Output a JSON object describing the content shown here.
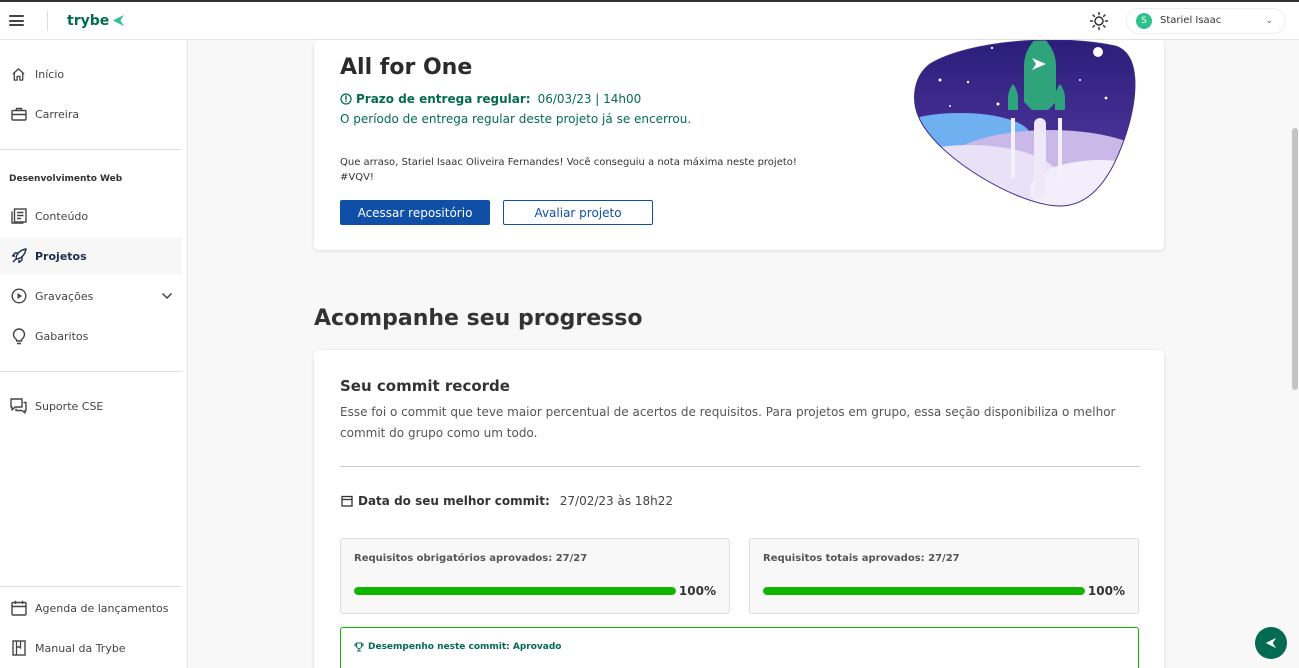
{
  "header": {
    "brand": "trybe",
    "user_initial": "S",
    "user_name": "Stariel Isaac"
  },
  "sidebar": {
    "items_top": [
      {
        "label": "Início",
        "icon": "home-icon"
      },
      {
        "label": "Carreira",
        "icon": "briefcase-icon"
      }
    ],
    "section_label": "Desenvolvimento Web",
    "items_web": [
      {
        "label": "Conteúdo",
        "icon": "content-icon"
      },
      {
        "label": "Projetos",
        "icon": "rocket-icon",
        "active": true
      },
      {
        "label": "Gravações",
        "icon": "play-icon"
      },
      {
        "label": "Gabaritos",
        "icon": "lightbulb-icon"
      }
    ],
    "support": {
      "label": "Suporte CSE",
      "icon": "chat-icon"
    },
    "items_bottom": [
      {
        "label": "Agenda de lançamentos",
        "icon": "calendar-icon"
      },
      {
        "label": "Manual da Trybe",
        "icon": "book-icon"
      }
    ]
  },
  "project": {
    "title": "All for One",
    "deadline_label": "Prazo de entrega regular:",
    "deadline_value": "06/03/23 | 14h00",
    "closed_text": "O período de entrega regular deste projeto já se encerrou.",
    "congrats_line1": "Que arraso, Stariel Isaac Oliveira Fernandes! Você conseguiu a nota máxima neste projeto!",
    "congrats_line2": "#VQV!",
    "btn_repo": "Acessar repositório",
    "btn_rate": "Avaliar projeto"
  },
  "progress": {
    "section_title": "Acompanhe seu progresso",
    "card_title": "Seu commit recorde",
    "description": "Esse foi o commit que teve maior percentual de acertos de requisitos. Para projetos em grupo, essa seção disponibiliza o melhor commit do grupo como um todo.",
    "best_commit_label": "Data do seu melhor commit:",
    "best_commit_value": "27/02/23 às 18h22",
    "mandatory": {
      "label": "Requisitos obrigatórios aprovados: 27/27",
      "percent": "100%",
      "fraction": 1.0
    },
    "total": {
      "label": "Requisitos totais aprovados: 27/27",
      "percent": "100%",
      "fraction": 1.0
    },
    "performance": "Desempenho neste commit: Aprovado"
  },
  "colors": {
    "brand_green": "#036b52",
    "primary_blue": "#0f4fa8",
    "progress_green": "#11b500"
  }
}
